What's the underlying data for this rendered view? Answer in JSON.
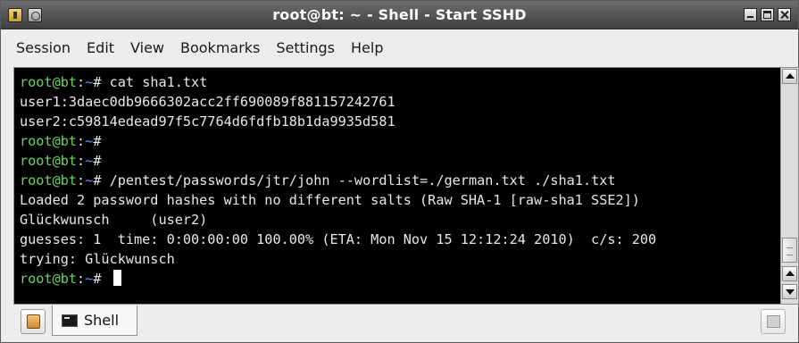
{
  "window": {
    "title": "root@bt: ~ - Shell - Start SSHD"
  },
  "menubar": {
    "items": [
      "Session",
      "Edit",
      "View",
      "Bookmarks",
      "Settings",
      "Help"
    ]
  },
  "terminal": {
    "prompt_user": "root@bt",
    "prompt_path": "~",
    "lines": [
      {
        "type": "prompt",
        "command": "cat sha1.txt"
      },
      {
        "type": "output",
        "text": "user1:3daec0db9666302acc2ff690089f881157242761"
      },
      {
        "type": "output",
        "text": "user2:c59814edead97f5c7764d6fdfb18b1da9935d581"
      },
      {
        "type": "prompt",
        "command": ""
      },
      {
        "type": "prompt",
        "command": ""
      },
      {
        "type": "prompt",
        "command": "/pentest/passwords/jtr/john --wordlist=./german.txt ./sha1.txt"
      },
      {
        "type": "output",
        "text": "Loaded 2 password hashes with no different salts (Raw SHA-1 [raw-sha1 SSE2])"
      },
      {
        "type": "output",
        "text": "Glückwunsch     (user2)"
      },
      {
        "type": "output",
        "text": "guesses: 1  time: 0:00:00:00 100.00% (ETA: Mon Nov 15 12:12:24 2010)  c/s: 200"
      },
      {
        "type": "output",
        "text": "trying: Glückwunsch"
      },
      {
        "type": "prompt",
        "command": "",
        "cursor": true
      }
    ]
  },
  "tabbar": {
    "tabs": [
      {
        "label": "Shell",
        "active": true
      }
    ]
  },
  "colors": {
    "prompt_user": "#68d461",
    "prompt_path": "#6f8fff",
    "terminal_bg": "#000000",
    "terminal_fg": "#e8e8e8"
  },
  "icons": {
    "app_menu": "window-menu-icon",
    "pin": "pin-icon",
    "minimize": "minimize-icon",
    "maximize": "maximize-icon",
    "close": "close-icon",
    "new_tab": "new-tab-icon",
    "close_tab": "close-tab-icon",
    "tab": "terminal-icon"
  }
}
